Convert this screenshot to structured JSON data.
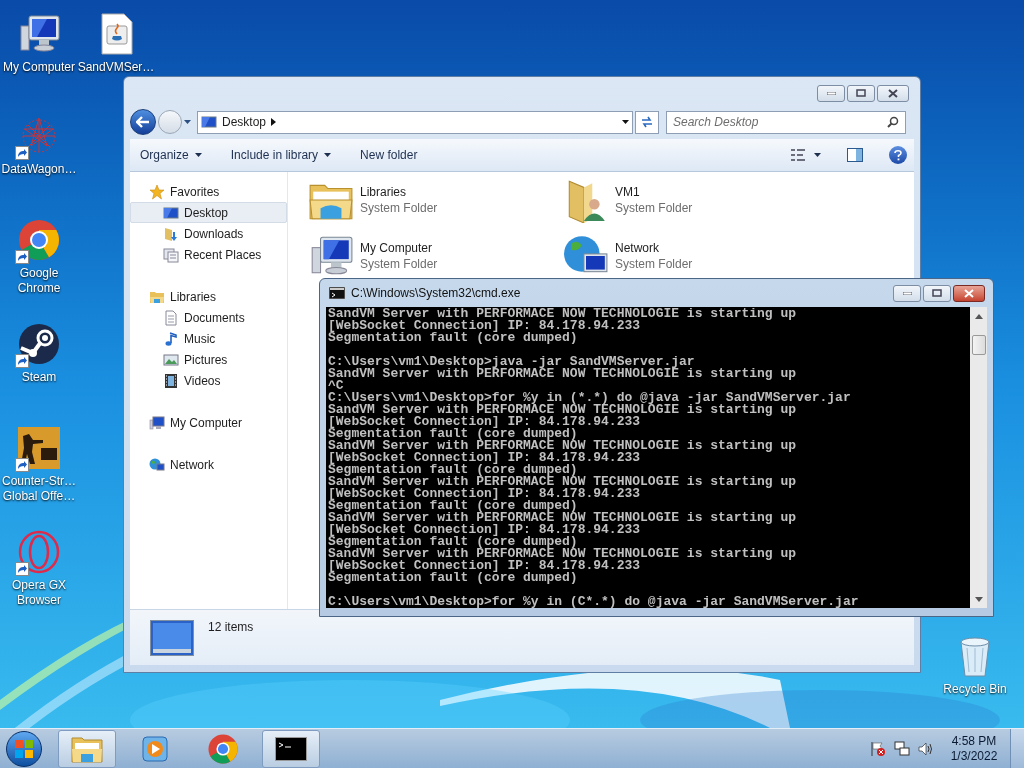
{
  "desktop_icons": [
    {
      "label": "My Computer",
      "kind": "computer",
      "shortcut": false
    },
    {
      "label": "SandVMSer…",
      "kind": "java-file",
      "shortcut": false
    },
    {
      "label": "DataWagon…",
      "kind": "network-star",
      "shortcut": true
    },
    {
      "label": "Google Chrome",
      "kind": "chrome",
      "shortcut": true
    },
    {
      "label": "Steam",
      "kind": "steam",
      "shortcut": true
    },
    {
      "label": "Counter-Str… Global Offe…",
      "kind": "game",
      "shortcut": true
    },
    {
      "label": "Opera GX Browser",
      "kind": "opera",
      "shortcut": true
    },
    {
      "label": "Recycle Bin",
      "kind": "recycle-bin",
      "shortcut": false
    }
  ],
  "explorer": {
    "address": "Desktop",
    "search_placeholder": "Search Desktop",
    "toolbar": [
      {
        "label": "Organize",
        "menu": true
      },
      {
        "label": "Include in library",
        "menu": true
      },
      {
        "label": "New folder",
        "menu": false
      }
    ],
    "nav": [
      {
        "label": "Favorites",
        "kind": "star",
        "selected": false,
        "children": [
          {
            "label": "Desktop",
            "kind": "desktop",
            "selected": true
          },
          {
            "label": "Downloads",
            "kind": "downloads",
            "selected": false
          },
          {
            "label": "Recent Places",
            "kind": "recent",
            "selected": false
          }
        ]
      },
      {
        "label": "Libraries",
        "kind": "library",
        "selected": false,
        "children": [
          {
            "label": "Documents",
            "kind": "document",
            "selected": false
          },
          {
            "label": "Music",
            "kind": "music",
            "selected": false
          },
          {
            "label": "Pictures",
            "kind": "pictures",
            "selected": false
          },
          {
            "label": "Videos",
            "kind": "videos",
            "selected": false
          }
        ]
      },
      {
        "label": "My Computer",
        "kind": "computer",
        "selected": false
      },
      {
        "label": "Network",
        "kind": "network",
        "selected": false
      }
    ],
    "items": [
      {
        "name": "Libraries",
        "type": "System Folder",
        "kind": "library"
      },
      {
        "name": "VM1",
        "type": "System Folder",
        "kind": "user-folder"
      },
      {
        "name": "My Computer",
        "type": "System Folder",
        "kind": "computer"
      },
      {
        "name": "Network",
        "type": "System Folder",
        "kind": "network"
      }
    ],
    "status": "12 items"
  },
  "cmd": {
    "title": "C:\\Windows\\System32\\cmd.exe",
    "blocks": [
      [
        "SandVM Server with PERFORMACE NOW TECHNOLOGIE is starting up",
        "[WebSocket Connection] IP: 84.178.94.233",
        "Segmentation fault (core dumped)"
      ],
      [
        "C:\\Users\\vm1\\Desktop>java -jar SandVMServer.jar",
        "SandVM Server with PERFORMACE NOW TECHNOLOGIE is starting up",
        "^C",
        "C:\\Users\\vm1\\Desktop>for %y in (*.*) do @java -jar SandVMServer.jar",
        "SandVM Server with PERFORMACE NOW TECHNOLOGIE is starting up",
        "[WebSocket Connection] IP: 84.178.94.233",
        "Segmentation fault (core dumped)",
        "SandVM Server with PERFORMACE NOW TECHNOLOGIE is starting up",
        "[WebSocket Connection] IP: 84.178.94.233",
        "Segmentation fault (core dumped)",
        "SandVM Server with PERFORMACE NOW TECHNOLOGIE is starting up",
        "[WebSocket Connection] IP: 84.178.94.233",
        "Segmentation fault (core dumped)",
        "SandVM Server with PERFORMACE NOW TECHNOLOGIE is starting up",
        "[WebSocket Connection] IP: 84.178.94.233",
        "Segmentation fault (core dumped)",
        "SandVM Server with PERFORMACE NOW TECHNOLOGIE is starting up",
        "[WebSocket Connection] IP: 84.178.94.233",
        "Segmentation fault (core dumped)"
      ],
      [
        "C:\\Users\\vm1\\Desktop>for %y in (C*.*) do @java -jar SandVMServer.jar"
      ]
    ]
  },
  "taskbar": {
    "apps": [
      {
        "kind": "explorer",
        "running": true
      },
      {
        "kind": "media-player",
        "running": false
      },
      {
        "kind": "chrome",
        "running": false
      },
      {
        "kind": "console",
        "running": true
      }
    ],
    "time": "4:58 PM",
    "date": "1/3/2022"
  }
}
